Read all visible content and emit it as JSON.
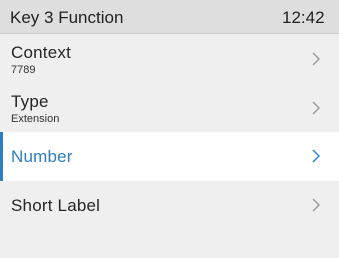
{
  "header": {
    "title": "Key 3 Function",
    "clock": "12:42"
  },
  "menu": {
    "items": [
      {
        "label": "Context",
        "value": "7789",
        "icon": "chevron-right-icon"
      },
      {
        "label": "Type",
        "value": "Extension",
        "icon": "chevron-right-icon"
      },
      {
        "label": "Number",
        "selected": true,
        "icon": "chevron-right-icon"
      },
      {
        "label": "Short Label",
        "icon": "chevron-right-icon"
      }
    ]
  },
  "colors": {
    "accent": "#2d7fc1",
    "header_bg": "#dedede",
    "background": "#efefef",
    "selected_bg": "#ffffff"
  }
}
